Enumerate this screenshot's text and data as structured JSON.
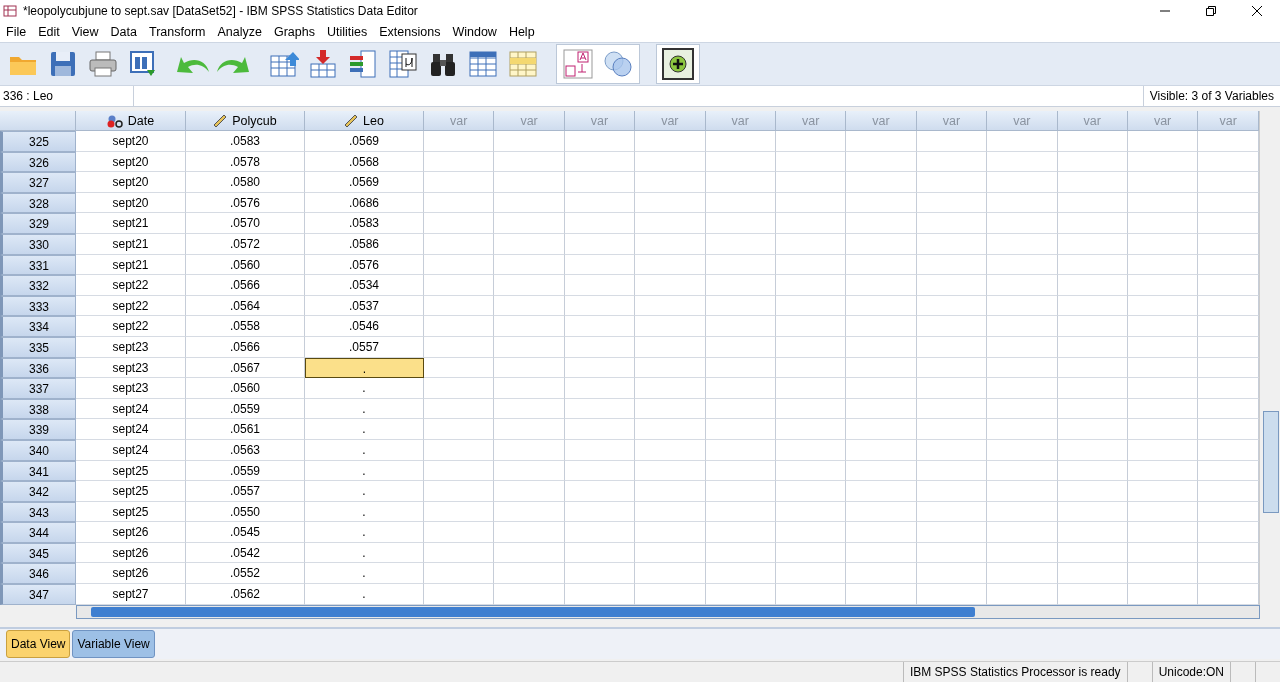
{
  "window": {
    "title": "*leopolycubjune to sept.sav [DataSet52] - IBM SPSS Statistics Data Editor"
  },
  "menu": [
    "File",
    "Edit",
    "View",
    "Data",
    "Transform",
    "Analyze",
    "Graphs",
    "Utilities",
    "Extensions",
    "Window",
    "Help"
  ],
  "cell_reference": "336 : Leo",
  "visible_info": "Visible: 3 of 3 Variables",
  "table": {
    "columns": [
      {
        "label": "Date",
        "kind": "nominal"
      },
      {
        "label": "Polycub",
        "kind": "scale"
      },
      {
        "label": "Leo",
        "kind": "scale"
      },
      {
        "label": "var",
        "kind": "empty"
      },
      {
        "label": "var",
        "kind": "empty"
      },
      {
        "label": "var",
        "kind": "empty"
      },
      {
        "label": "var",
        "kind": "empty"
      },
      {
        "label": "var",
        "kind": "empty"
      },
      {
        "label": "var",
        "kind": "empty"
      },
      {
        "label": "var",
        "kind": "empty"
      },
      {
        "label": "var",
        "kind": "empty"
      },
      {
        "label": "var",
        "kind": "empty"
      },
      {
        "label": "var",
        "kind": "empty"
      },
      {
        "label": "var",
        "kind": "empty"
      },
      {
        "label": "var",
        "kind": "empty"
      }
    ],
    "rows": [
      {
        "number": "325",
        "cells": [
          {
            "text": "sept20",
            "selected": false
          },
          {
            "text": ".0583",
            "selected": false
          },
          {
            "text": ".0569",
            "selected": false
          }
        ]
      },
      {
        "number": "326",
        "cells": [
          {
            "text": "sept20",
            "selected": false
          },
          {
            "text": ".0578",
            "selected": false
          },
          {
            "text": ".0568",
            "selected": false
          }
        ]
      },
      {
        "number": "327",
        "cells": [
          {
            "text": "sept20",
            "selected": false
          },
          {
            "text": ".0580",
            "selected": false
          },
          {
            "text": ".0569",
            "selected": false
          }
        ]
      },
      {
        "number": "328",
        "cells": [
          {
            "text": "sept20",
            "selected": false
          },
          {
            "text": ".0576",
            "selected": false
          },
          {
            "text": ".0686",
            "selected": false
          }
        ]
      },
      {
        "number": "329",
        "cells": [
          {
            "text": "sept21",
            "selected": false
          },
          {
            "text": ".0570",
            "selected": false
          },
          {
            "text": ".0583",
            "selected": false
          }
        ]
      },
      {
        "number": "330",
        "cells": [
          {
            "text": "sept21",
            "selected": false
          },
          {
            "text": ".0572",
            "selected": false
          },
          {
            "text": ".0586",
            "selected": false
          }
        ]
      },
      {
        "number": "331",
        "cells": [
          {
            "text": "sept21",
            "selected": false
          },
          {
            "text": ".0560",
            "selected": false
          },
          {
            "text": ".0576",
            "selected": false
          }
        ]
      },
      {
        "number": "332",
        "cells": [
          {
            "text": "sept22",
            "selected": false
          },
          {
            "text": ".0566",
            "selected": false
          },
          {
            "text": ".0534",
            "selected": false
          }
        ]
      },
      {
        "number": "333",
        "cells": [
          {
            "text": "sept22",
            "selected": false
          },
          {
            "text": ".0564",
            "selected": false
          },
          {
            "text": ".0537",
            "selected": false
          }
        ]
      },
      {
        "number": "334",
        "cells": [
          {
            "text": "sept22",
            "selected": false
          },
          {
            "text": ".0558",
            "selected": false
          },
          {
            "text": ".0546",
            "selected": false
          }
        ]
      },
      {
        "number": "335",
        "cells": [
          {
            "text": "sept23",
            "selected": false
          },
          {
            "text": ".0566",
            "selected": false
          },
          {
            "text": ".0557",
            "selected": false
          }
        ]
      },
      {
        "number": "336",
        "cells": [
          {
            "text": "sept23",
            "selected": false
          },
          {
            "text": ".0567",
            "selected": false
          },
          {
            "text": ".",
            "selected": true
          }
        ]
      },
      {
        "number": "337",
        "cells": [
          {
            "text": "sept23",
            "selected": false
          },
          {
            "text": ".0560",
            "selected": false
          },
          {
            "text": ".",
            "selected": false
          }
        ]
      },
      {
        "number": "338",
        "cells": [
          {
            "text": "sept24",
            "selected": false
          },
          {
            "text": ".0559",
            "selected": false
          },
          {
            "text": ".",
            "selected": false
          }
        ]
      },
      {
        "number": "339",
        "cells": [
          {
            "text": "sept24",
            "selected": false
          },
          {
            "text": ".0561",
            "selected": false
          },
          {
            "text": ".",
            "selected": false
          }
        ]
      },
      {
        "number": "340",
        "cells": [
          {
            "text": "sept24",
            "selected": false
          },
          {
            "text": ".0563",
            "selected": false
          },
          {
            "text": ".",
            "selected": false
          }
        ]
      },
      {
        "number": "341",
        "cells": [
          {
            "text": "sept25",
            "selected": false
          },
          {
            "text": ".0559",
            "selected": false
          },
          {
            "text": ".",
            "selected": false
          }
        ]
      },
      {
        "number": "342",
        "cells": [
          {
            "text": "sept25",
            "selected": false
          },
          {
            "text": ".0557",
            "selected": false
          },
          {
            "text": ".",
            "selected": false
          }
        ]
      },
      {
        "number": "343",
        "cells": [
          {
            "text": "sept25",
            "selected": false
          },
          {
            "text": ".0550",
            "selected": false
          },
          {
            "text": ".",
            "selected": false
          }
        ]
      },
      {
        "number": "344",
        "cells": [
          {
            "text": "sept26",
            "selected": false
          },
          {
            "text": ".0545",
            "selected": false
          },
          {
            "text": ".",
            "selected": false
          }
        ]
      },
      {
        "number": "345",
        "cells": [
          {
            "text": "sept26",
            "selected": false
          },
          {
            "text": ".0542",
            "selected": false
          },
          {
            "text": ".",
            "selected": false
          }
        ]
      },
      {
        "number": "346",
        "cells": [
          {
            "text": "sept26",
            "selected": false
          },
          {
            "text": ".0552",
            "selected": false
          },
          {
            "text": ".",
            "selected": false
          }
        ]
      },
      {
        "number": "347",
        "cells": [
          {
            "text": "sept27",
            "selected": false
          },
          {
            "text": ".0562",
            "selected": false
          },
          {
            "text": ".",
            "selected": false
          }
        ]
      }
    ]
  },
  "view_tabs": [
    {
      "label": "Data View",
      "selected": true
    },
    {
      "label": "Variable View",
      "selected": false
    }
  ],
  "status_bar": [
    "IBM SPSS Statistics Processor is ready",
    "Unicode:ON"
  ]
}
